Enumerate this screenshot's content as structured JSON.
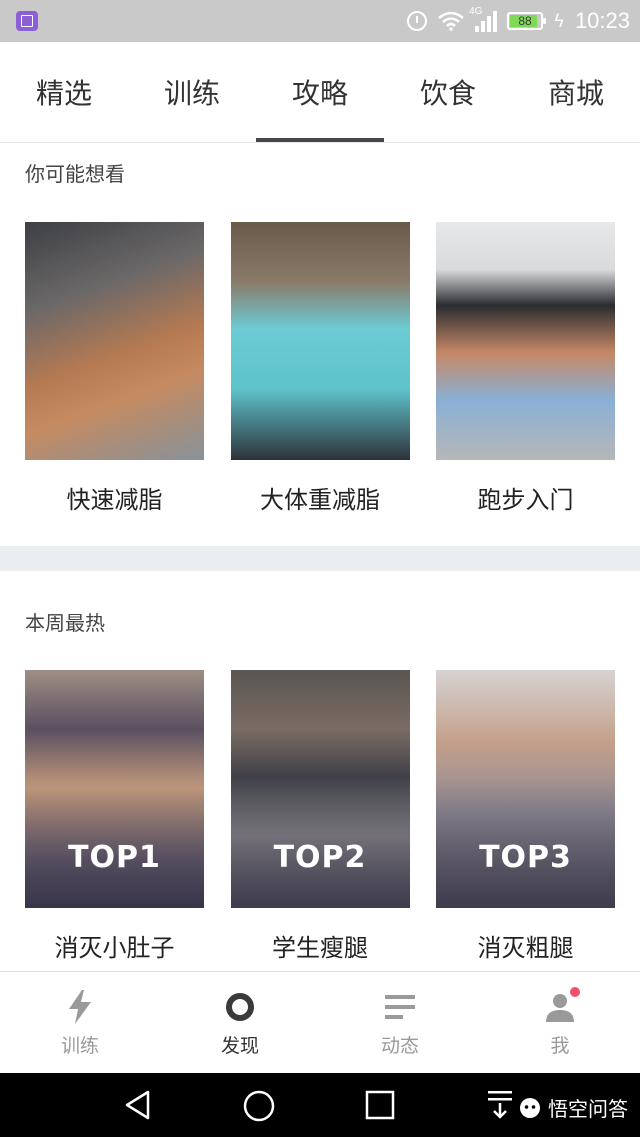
{
  "status_bar": {
    "time": "10:23",
    "battery": "88",
    "network": "4G"
  },
  "tabs": [
    {
      "label": "精选"
    },
    {
      "label": "训练"
    },
    {
      "label": "攻略",
      "active": true
    },
    {
      "label": "饮食"
    },
    {
      "label": "商城"
    }
  ],
  "recommend": {
    "title": "你可能想看",
    "items": [
      {
        "caption": "快速减脂"
      },
      {
        "caption": "大体重减脂"
      },
      {
        "caption": "跑步入门"
      }
    ]
  },
  "hot": {
    "title": "本周最热",
    "items": [
      {
        "badge": "TOP1",
        "caption": "消灭小肚子"
      },
      {
        "badge": "TOP2",
        "caption": "学生瘦腿"
      },
      {
        "badge": "TOP3",
        "caption": "消灭粗腿"
      }
    ]
  },
  "bottom_nav": [
    {
      "label": "训练",
      "icon": "lightning-icon"
    },
    {
      "label": "发现",
      "icon": "ring-icon",
      "active": true
    },
    {
      "label": "动态",
      "icon": "lines-icon"
    },
    {
      "label": "我",
      "icon": "person-icon",
      "has_badge": true
    }
  ],
  "watermark": "悟空问答",
  "colors": {
    "accent": "#4a4552",
    "badge": "#f0506e",
    "inactive": "#9a9a9a"
  }
}
